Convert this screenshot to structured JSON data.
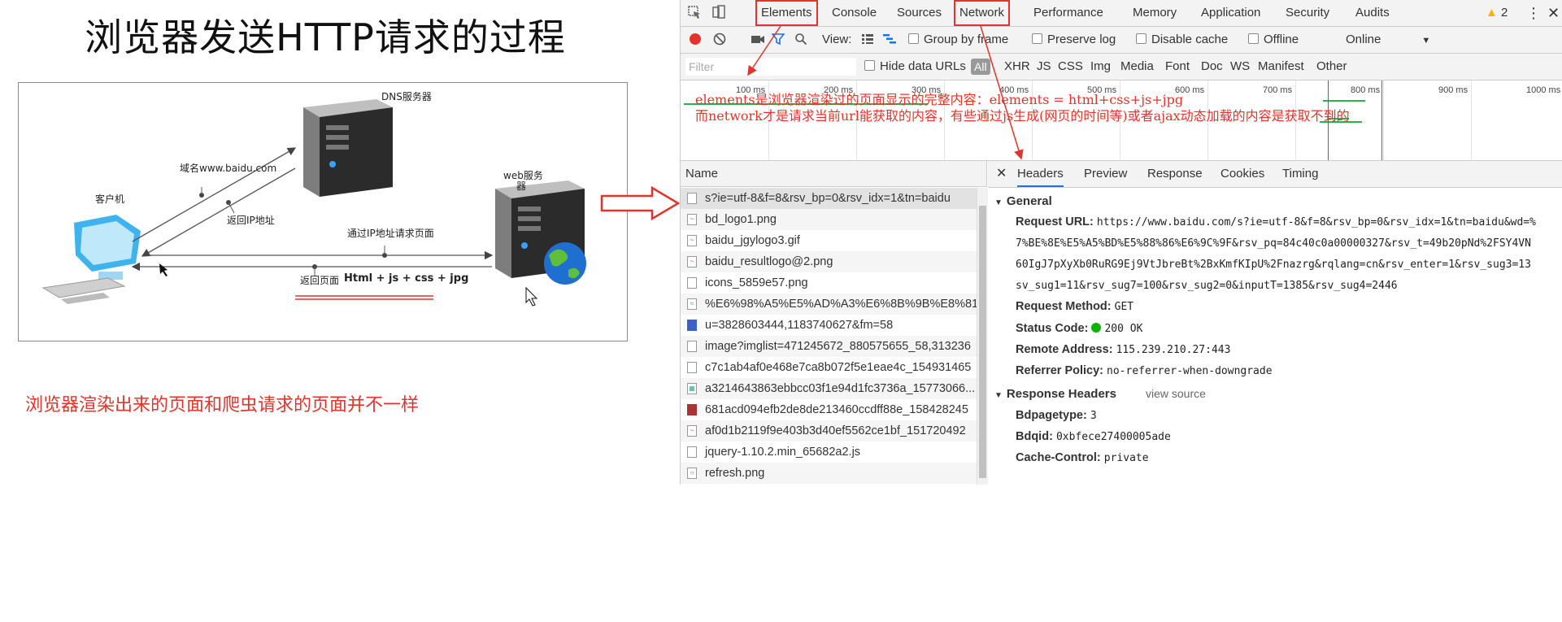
{
  "slide": {
    "title": "浏览器发送HTTP请求的过程",
    "note": "浏览器渲染出来的页面和爬虫请求的页面并不一样",
    "diagram": {
      "dns_server": "DNS服务器",
      "web_server_1": "web服务",
      "web_server_2": "器",
      "client": "客户机",
      "domain_label": "域名www.baidu.com",
      "return_ip": "返回IP地址",
      "request_by_ip": "通过IP地址请求页面",
      "return_page": "返回页面",
      "return_content": "Html + js + css + jpg"
    }
  },
  "devtools": {
    "tabs": [
      "Elements",
      "Console",
      "Sources",
      "Network",
      "Performance",
      "Memory",
      "Application",
      "Security",
      "Audits"
    ],
    "active_tab": "Network",
    "warning_count": "2",
    "toolbar": {
      "view_label": "View:",
      "group_by_frame": "Group by frame",
      "preserve_log": "Preserve log",
      "disable_cache": "Disable cache",
      "offline": "Offline",
      "throttle": "Online"
    },
    "filter_bar": {
      "placeholder": "Filter",
      "hide_data_urls": "Hide data URLs",
      "types": [
        "All",
        "XHR",
        "JS",
        "CSS",
        "Img",
        "Media",
        "Font",
        "Doc",
        "WS",
        "Manifest",
        "Other"
      ]
    },
    "timeline_ticks": [
      "100 ms",
      "200 ms",
      "300 ms",
      "400 ms",
      "500 ms",
      "600 ms",
      "700 ms",
      "800 ms",
      "900 ms",
      "1000 ms"
    ],
    "annotation_line1": "elements是浏览器渲染过的页面显示的完整内容：elements = html+css+js+jpg",
    "annotation_line2": "而network才是请求当前url能获取的内容，有些通过js生成(网页的时间等)或者ajax动态加载的内容是获取不到的",
    "name_header": "Name",
    "requests": [
      "s?ie=utf-8&f=8&rsv_bp=0&rsv_idx=1&tn=baidu",
      "bd_logo1.png",
      "baidu_jgylogo3.gif",
      "baidu_resultlogo@2.png",
      "icons_5859e57.png",
      "%E6%98%A5%E5%AD%A3%E6%8B%9B%E8%81...",
      "u=3828603444,1183740627&fm=58",
      "image?imglist=471245672_880575655_58,313236",
      "c7c1ab4af0e468e7ca8b072f5e1eae4c_154931465",
      "a3214643863ebbcc03f1e94d1fc3736a_15773066...",
      "681acd094efb2de8de213460ccdff88e_158428245",
      "af0d1b2119f9e403b3d40ef5562ce1bf_151720492",
      "jquery-1.10.2.min_65682a2.js",
      "refresh.png"
    ],
    "detail_tabs": [
      "Headers",
      "Preview",
      "Response",
      "Cookies",
      "Timing"
    ],
    "general": {
      "title": "General",
      "request_url_label": "Request URL:",
      "request_url_1": "https://www.baidu.com/s?ie=utf-8&f=8&rsv_bp=0&rsv_idx=1&tn=baidu&wd=%",
      "request_url_2": "7%BE%8E%E5%A5%BD%E5%88%86%E6%9C%9F&rsv_pq=84c40c0a00000327&rsv_t=49b20pNd%2FSY4VN",
      "request_url_3": "60IgJ7pXyXb0RuRG9Ej9VtJbreBt%2BxKmfKIpU%2Fnazrg&rqlang=cn&rsv_enter=1&rsv_sug3=13",
      "request_url_4": "sv_sug1=11&rsv_sug7=100&rsv_sug2=0&inputT=1385&rsv_sug4=2446",
      "method_label": "Request Method:",
      "method": "GET",
      "status_label": "Status Code:",
      "status": "200 OK",
      "remote_label": "Remote Address:",
      "remote": "115.239.210.27:443",
      "referrer_label": "Referrer Policy:",
      "referrer": "no-referrer-when-downgrade"
    },
    "response_headers": {
      "title": "Response Headers",
      "view_source": "view source",
      "bdpagetype_label": "Bdpagetype:",
      "bdpagetype": "3",
      "bdqid_label": "Bdqid:",
      "bdqid": "0xbfece27400005ade",
      "cache_label": "Cache-Control:",
      "cache": "private"
    }
  }
}
